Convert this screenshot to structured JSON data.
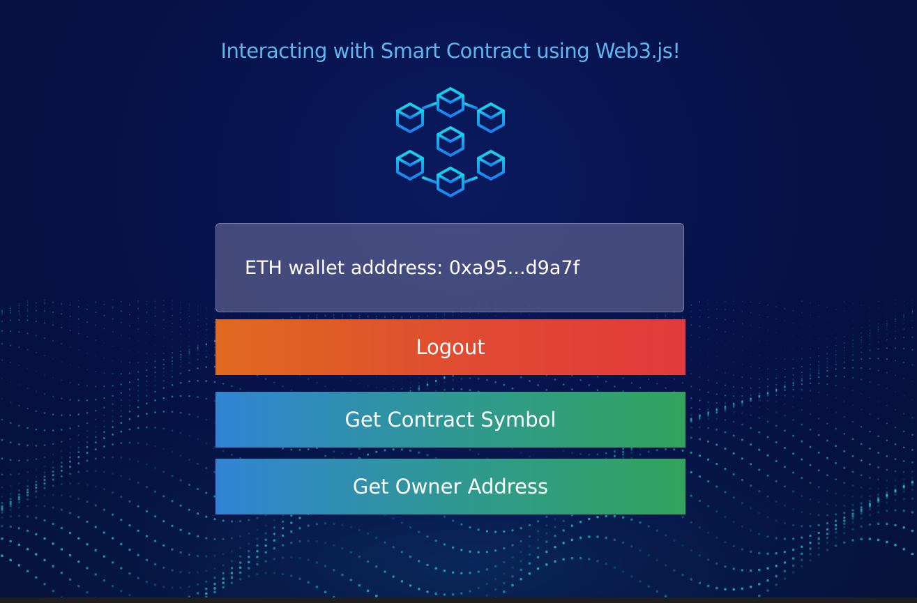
{
  "page": {
    "title": "Interacting with Smart Contract using Web3.js!",
    "logo_icon": "blockchain-cubes-icon"
  },
  "wallet": {
    "label": "ETH wallet adddress: 0xa95...d9a7f"
  },
  "buttons": {
    "logout": "Logout",
    "get_symbol": "Get Contract Symbol",
    "get_owner": "Get Owner Address"
  },
  "colors": {
    "title": "#5fb6ee",
    "logout_start": "#e06a1f",
    "logout_end": "#e23a3c",
    "action_start": "#3183d3",
    "action_end": "#33a35c",
    "background": "#06124a"
  }
}
